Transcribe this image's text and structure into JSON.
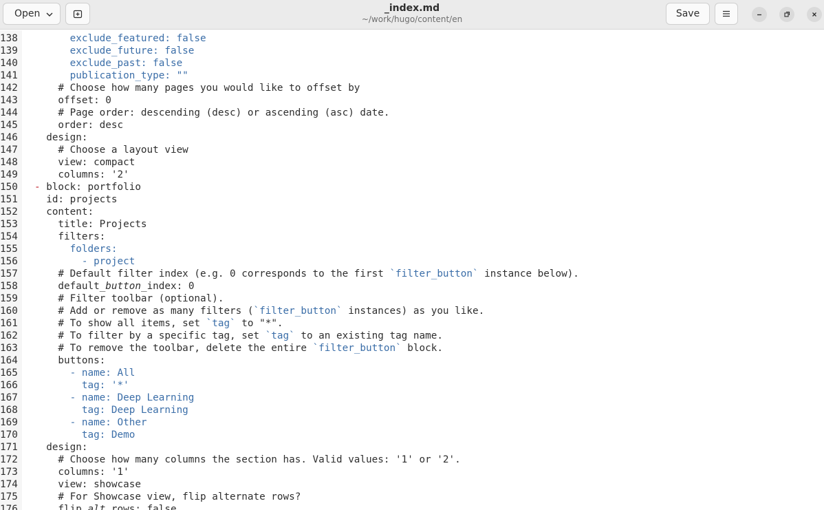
{
  "window": {
    "title": "_index.md",
    "subtitle": "~/work/hugo/content/en"
  },
  "toolbar": {
    "open_label": "Open",
    "save_label": "Save"
  },
  "icons": [
    "chevron-down-icon",
    "new-tab-icon",
    "hamburger-menu-icon",
    "minimize-icon",
    "maximize-icon",
    "close-icon"
  ],
  "colors": {
    "keyword_blue": "#3b6ea8",
    "list_marker_red": "#c01c28",
    "text": "#2e2e2e"
  },
  "lines": [
    {
      "n": "138",
      "segs": [
        {
          "t": "      exclude_featured: false",
          "c": "blue"
        }
      ]
    },
    {
      "n": "139",
      "segs": [
        {
          "t": "      exclude_future: false",
          "c": "blue"
        }
      ]
    },
    {
      "n": "140",
      "segs": [
        {
          "t": "      exclude_past: false",
          "c": "blue"
        }
      ]
    },
    {
      "n": "141",
      "segs": [
        {
          "t": "      publication_type: \"\"",
          "c": "blue"
        }
      ]
    },
    {
      "n": "142",
      "segs": [
        {
          "t": "    # Choose how many pages you would like to offset by",
          "c": "default"
        }
      ]
    },
    {
      "n": "143",
      "segs": [
        {
          "t": "    offset: 0",
          "c": "default"
        }
      ]
    },
    {
      "n": "144",
      "segs": [
        {
          "t": "    # Page order: descending (desc) or ascending (asc) date.",
          "c": "default"
        }
      ]
    },
    {
      "n": "145",
      "segs": [
        {
          "t": "    order: desc",
          "c": "default"
        }
      ]
    },
    {
      "n": "146",
      "segs": [
        {
          "t": "  design:",
          "c": "default"
        }
      ]
    },
    {
      "n": "147",
      "segs": [
        {
          "t": "    # Choose a layout view",
          "c": "default"
        }
      ]
    },
    {
      "n": "148",
      "segs": [
        {
          "t": "    view: compact",
          "c": "default"
        }
      ]
    },
    {
      "n": "149",
      "segs": [
        {
          "t": "    columns: '2'",
          "c": "default"
        }
      ]
    },
    {
      "n": "150",
      "segs": [
        {
          "t": "- ",
          "c": "red"
        },
        {
          "t": "block: portfolio",
          "c": "default"
        }
      ]
    },
    {
      "n": "151",
      "segs": [
        {
          "t": "  id: projects",
          "c": "default"
        }
      ]
    },
    {
      "n": "152",
      "segs": [
        {
          "t": "  content:",
          "c": "default"
        }
      ]
    },
    {
      "n": "153",
      "segs": [
        {
          "t": "    title: Projects",
          "c": "default"
        }
      ]
    },
    {
      "n": "154",
      "segs": [
        {
          "t": "    filters:",
          "c": "default"
        }
      ]
    },
    {
      "n": "155",
      "segs": [
        {
          "t": "      folders:",
          "c": "blue"
        }
      ]
    },
    {
      "n": "156",
      "segs": [
        {
          "t": "        - project",
          "c": "blue"
        }
      ]
    },
    {
      "n": "157",
      "segs": [
        {
          "t": "    # Default filter index (e.g. 0 corresponds to the first ",
          "c": "default"
        },
        {
          "t": "`filter_button`",
          "c": "blue"
        },
        {
          "t": " instance below).",
          "c": "default"
        }
      ]
    },
    {
      "n": "158",
      "segs": [
        {
          "t": "    default",
          "c": "default"
        },
        {
          "t": "_button_",
          "c": "italic"
        },
        {
          "t": "index: 0",
          "c": "default"
        }
      ]
    },
    {
      "n": "159",
      "segs": [
        {
          "t": "    # Filter toolbar (optional).",
          "c": "default"
        }
      ]
    },
    {
      "n": "160",
      "segs": [
        {
          "t": "    # Add or remove as many filters (",
          "c": "default"
        },
        {
          "t": "`filter_button`",
          "c": "blue"
        },
        {
          "t": " instances) as you like.",
          "c": "default"
        }
      ]
    },
    {
      "n": "161",
      "segs": [
        {
          "t": "    # To show all items, set ",
          "c": "default"
        },
        {
          "t": "`tag`",
          "c": "blue"
        },
        {
          "t": " to \"*\".",
          "c": "default"
        }
      ]
    },
    {
      "n": "162",
      "segs": [
        {
          "t": "    # To filter by a specific tag, set ",
          "c": "default"
        },
        {
          "t": "`tag`",
          "c": "blue"
        },
        {
          "t": " to an existing tag name.",
          "c": "default"
        }
      ]
    },
    {
      "n": "163",
      "segs": [
        {
          "t": "    # To remove the toolbar, delete the entire ",
          "c": "default"
        },
        {
          "t": "`filter_button`",
          "c": "blue"
        },
        {
          "t": " block.",
          "c": "default"
        }
      ]
    },
    {
      "n": "164",
      "segs": [
        {
          "t": "    buttons:",
          "c": "default"
        }
      ]
    },
    {
      "n": "165",
      "segs": [
        {
          "t": "      - name: All",
          "c": "blue"
        }
      ]
    },
    {
      "n": "166",
      "segs": [
        {
          "t": "        tag: '*'",
          "c": "blue"
        }
      ]
    },
    {
      "n": "167",
      "segs": [
        {
          "t": "      - name: Deep Learning",
          "c": "blue"
        }
      ]
    },
    {
      "n": "168",
      "segs": [
        {
          "t": "        tag: Deep Learning",
          "c": "blue"
        }
      ]
    },
    {
      "n": "169",
      "segs": [
        {
          "t": "      - name: Other",
          "c": "blue"
        }
      ]
    },
    {
      "n": "170",
      "segs": [
        {
          "t": "        tag: Demo",
          "c": "blue"
        }
      ]
    },
    {
      "n": "171",
      "segs": [
        {
          "t": "  design:",
          "c": "default"
        }
      ]
    },
    {
      "n": "172",
      "segs": [
        {
          "t": "    # Choose how many columns the section has. Valid values: '1' or '2'.",
          "c": "default"
        }
      ]
    },
    {
      "n": "173",
      "segs": [
        {
          "t": "    columns: '1'",
          "c": "default"
        }
      ]
    },
    {
      "n": "174",
      "segs": [
        {
          "t": "    view: showcase",
          "c": "default"
        }
      ]
    },
    {
      "n": "175",
      "segs": [
        {
          "t": "    # For Showcase view, flip alternate rows?",
          "c": "default"
        }
      ]
    },
    {
      "n": "176",
      "segs": [
        {
          "t": "    flip",
          "c": "default"
        },
        {
          "t": "_alt_",
          "c": "italic"
        },
        {
          "t": "rows: false",
          "c": "default"
        }
      ]
    }
  ]
}
